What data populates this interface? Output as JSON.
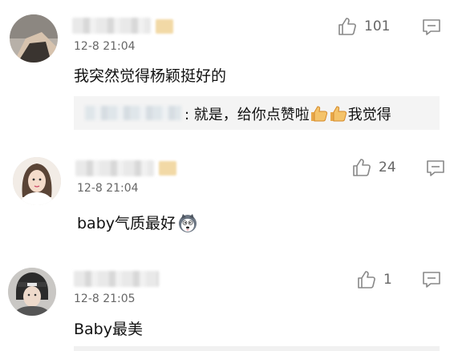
{
  "comments": [
    {
      "timestamp": "12-8 21:04",
      "content": "我突然觉得杨颖挺好的",
      "likes": "101",
      "reply": {
        "text": ": 就是，给你点赞啦",
        "suffix": "我觉得",
        "emoji": "thumbs-up-icon"
      }
    },
    {
      "timestamp": "12-8 21:04",
      "content": "baby气质最好",
      "likes": "24",
      "emoji": "husky-face-icon"
    },
    {
      "timestamp": "12-8 21:05",
      "content": "Baby最美",
      "likes": "1"
    }
  ],
  "colors": {
    "like_icon": "#888888",
    "muted_text": "#666666",
    "reply_bg": "#f4f4f4"
  }
}
